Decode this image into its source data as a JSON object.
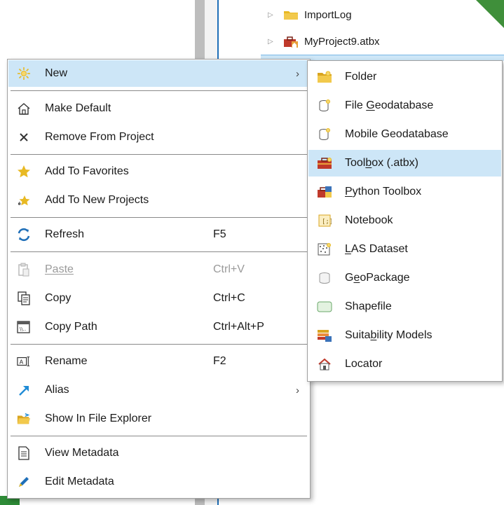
{
  "tree": {
    "items": [
      {
        "label": "ImportLog",
        "icon": "folder-icon"
      },
      {
        "label": "MyProject9.atbx",
        "icon": "toolbox-icon"
      }
    ]
  },
  "context_menu": {
    "items": [
      {
        "label": "New",
        "shortcut": "",
        "has_submenu": true,
        "icon": "sun-new-icon"
      },
      {
        "label": "Make Default",
        "shortcut": "",
        "icon": "home-icon"
      },
      {
        "label": "Remove From Project",
        "shortcut": "",
        "icon": "x-icon"
      },
      {
        "label": "Add To Favorites",
        "shortcut": "",
        "icon": "star-icon"
      },
      {
        "label": "Add To New Projects",
        "shortcut": "",
        "icon": "star-sparkle-icon"
      },
      {
        "label": "Refresh",
        "shortcut": "F5",
        "icon": "refresh-icon"
      },
      {
        "label": "Paste",
        "shortcut": "Ctrl+V",
        "disabled": true,
        "icon": "paste-icon"
      },
      {
        "label": "Copy",
        "shortcut": "Ctrl+C",
        "icon": "copy-icon"
      },
      {
        "label": "Copy Path",
        "shortcut": "Ctrl+Alt+P",
        "icon": "copy-path-icon"
      },
      {
        "label": "Rename",
        "shortcut": "F2",
        "icon": "rename-icon"
      },
      {
        "label": "Alias",
        "shortcut": "",
        "has_submenu": true,
        "icon": "alias-arrow-icon"
      },
      {
        "label": "Show In File Explorer",
        "shortcut": "",
        "icon": "open-folder-icon"
      },
      {
        "label": "View Metadata",
        "shortcut": "",
        "icon": "document-icon"
      },
      {
        "label": "Edit Metadata",
        "shortcut": "",
        "icon": "pencil-icon"
      }
    ],
    "submenu_arrow": "›"
  },
  "new_submenu": {
    "items": [
      {
        "label": "Folder",
        "icon": "new-folder-icon"
      },
      {
        "label": "File Geodatabase",
        "icon": "file-geodatabase-icon"
      },
      {
        "label": "Mobile Geodatabase",
        "icon": "mobile-geodatabase-icon"
      },
      {
        "label": "Toolbox (.atbx)",
        "icon": "toolbox-icon"
      },
      {
        "label": "Python Toolbox",
        "icon": "python-toolbox-icon"
      },
      {
        "label": "Notebook",
        "icon": "notebook-icon"
      },
      {
        "label": "LAS Dataset",
        "icon": "las-dataset-icon"
      },
      {
        "label": "GeoPackage",
        "icon": "geopackage-icon"
      },
      {
        "label": "Shapefile",
        "icon": "shapefile-icon"
      },
      {
        "label": "Suitability Models",
        "icon": "suitability-model-icon"
      },
      {
        "label": "Locator",
        "icon": "locator-icon"
      }
    ]
  },
  "colors": {
    "highlight": "#cde6f7",
    "folder_yellow": "#e8b923",
    "accent_blue": "#1f6fb8"
  }
}
